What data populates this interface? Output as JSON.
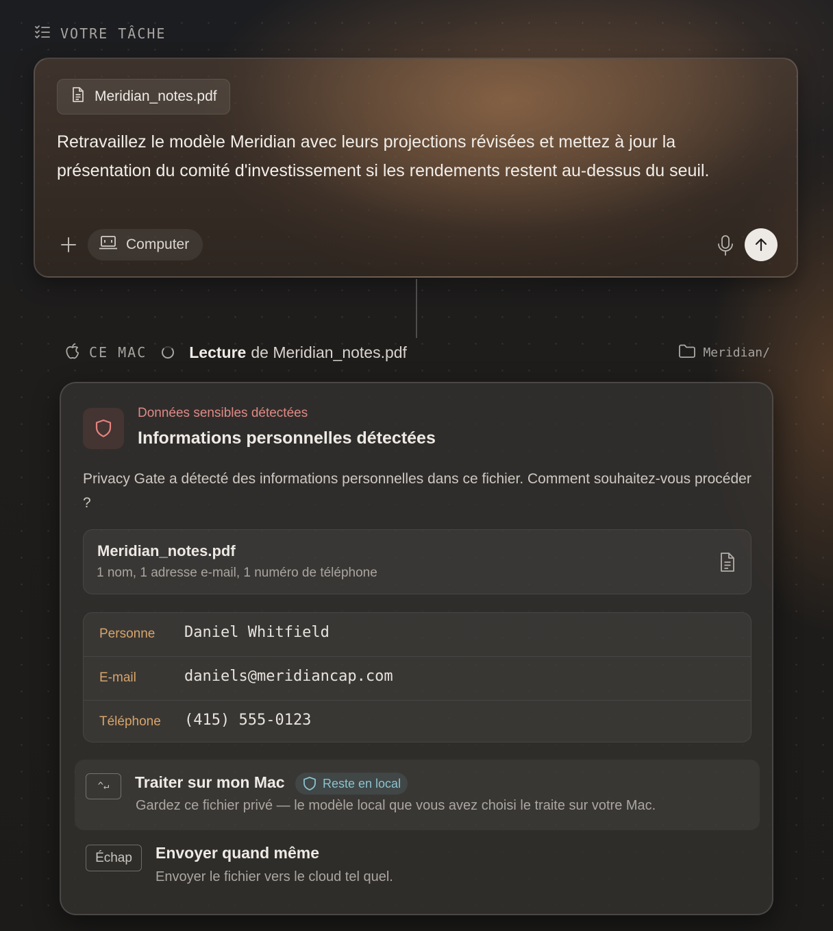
{
  "header": {
    "label": "VOTRE TÂCHE",
    "icon": "task-list-icon"
  },
  "prompt": {
    "attachment": "Meridian_notes.pdf",
    "text": "Retravaillez le modèle Meridian avec leurs projections révisées et mettez à jour la présentation du comité d'investissement si les rendements restent au-dessus du seuil.",
    "tool_chip": "Computer"
  },
  "status": {
    "device": "CE MAC",
    "action_bold": "Lecture",
    "action_rest": "de Meridian_notes.pdf",
    "folder": "Meridian/"
  },
  "privacy": {
    "kicker": "Données sensibles détectées",
    "title": "Informations personnelles détectées",
    "description": "Privacy Gate a détecté des informations personnelles dans ce fichier. Comment souhaitez-vous procéder ?",
    "file": {
      "name": "Meridian_notes.pdf",
      "summary": "1 nom, 1 adresse e-mail, 1 numéro de téléphone"
    },
    "fields": [
      {
        "label": "Personne",
        "value": "Daniel Whitfield"
      },
      {
        "label": "E-mail",
        "value": "daniels@meridiancap.com"
      },
      {
        "label": "Téléphone",
        "value": "(415) 555-0123"
      }
    ],
    "options": {
      "local": {
        "key": "^↵",
        "title": "Traiter sur mon Mac",
        "badge": "Reste en local",
        "subtitle": "Gardez ce fichier privé — le modèle local que vous avez choisi le traite sur votre Mac."
      },
      "send": {
        "key": "Échap",
        "title": "Envoyer quand même",
        "subtitle": "Envoyer le fichier vers le cloud tel quel."
      }
    }
  },
  "colors": {
    "alert": "#e08a86",
    "field_label": "#d8a56b",
    "local_badge": "#8ec3cf"
  }
}
